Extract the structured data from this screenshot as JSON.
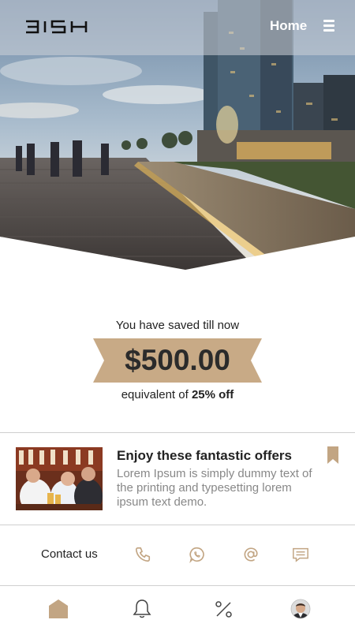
{
  "header": {
    "logo_text": "3ISH",
    "home_label": "Home"
  },
  "savings": {
    "caption": "You have saved till now",
    "amount": "$500.00",
    "equivalent_prefix": "equivalent of",
    "discount": "25% off"
  },
  "offer": {
    "title": "Enjoy these fantastic offers",
    "description": "Lorem Ipsum is simply dummy text of the printing and typesetting lorem ipsum text demo."
  },
  "contact": {
    "label": "Contact us"
  },
  "colors": {
    "accent": "#c2a583",
    "accent_dark": "#9a7b58",
    "text": "#222222",
    "muted": "#888888"
  },
  "icons": {
    "contact": [
      "phone-icon",
      "whatsapp-icon",
      "at-icon",
      "message-icon"
    ],
    "nav": [
      "home-icon",
      "bell-icon",
      "percent-icon",
      "avatar"
    ]
  }
}
